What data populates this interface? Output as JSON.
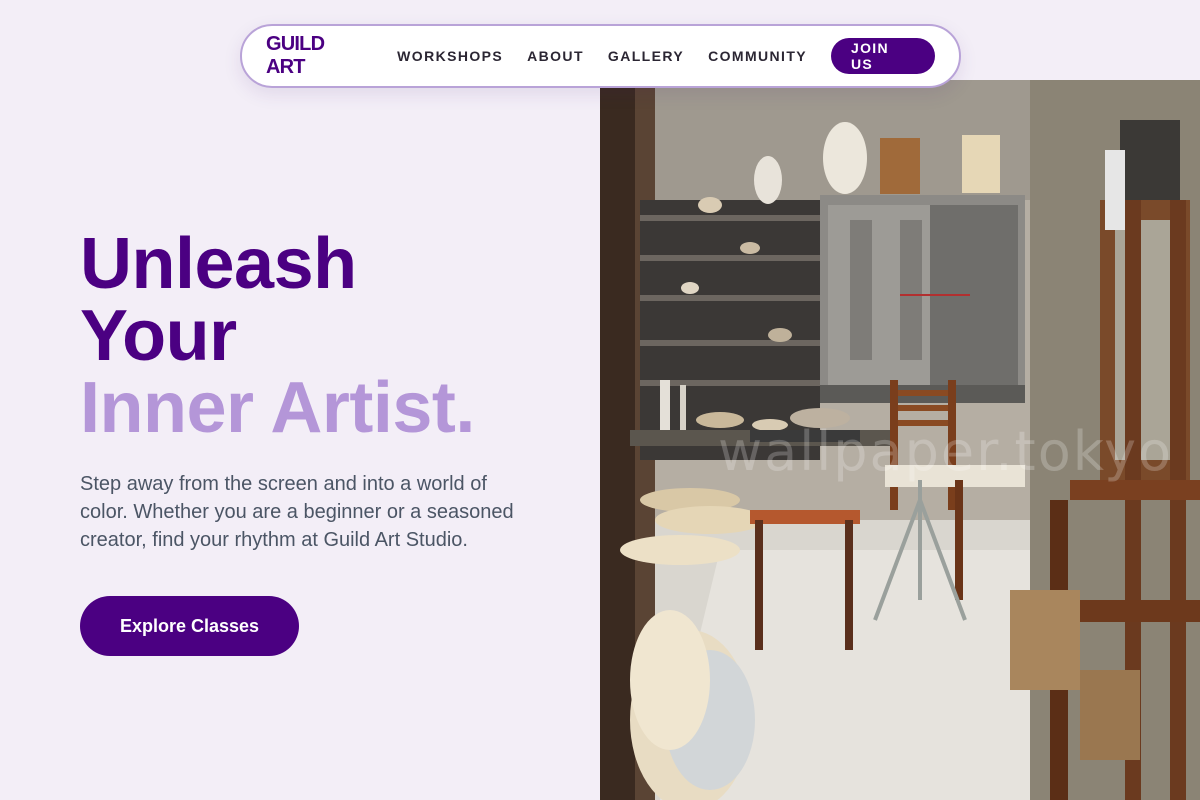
{
  "nav": {
    "logo": "GUILD ART",
    "links": [
      "WORKSHOPS",
      "ABOUT",
      "GALLERY",
      "COMMUNITY"
    ],
    "cta": "JOIN US"
  },
  "hero": {
    "headline_line1": "Unleash",
    "headline_line2": "Your",
    "headline_line3": "Inner Artist.",
    "subtext": "Step away from the screen and into a world of color. Whether you are a beginner or a seasoned creator, find your rhythm at Guild Art Studio.",
    "cta": "Explore Classes"
  },
  "image": {
    "subject": "pottery-studio-photo",
    "watermark": "wallpaper.tokyo"
  },
  "colors": {
    "brand": "#4b0082",
    "accent_light": "#b496d8",
    "background": "#f3eef7",
    "body_text": "#4b5565"
  }
}
